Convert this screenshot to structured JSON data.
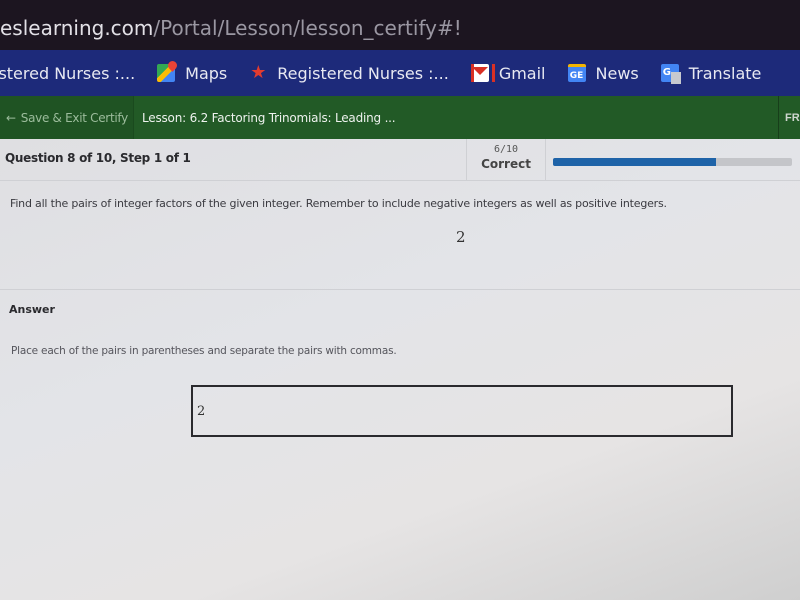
{
  "browser": {
    "url_host": "eslearning.com",
    "url_path": "/Portal/Lesson/lesson_certify#!"
  },
  "bookmarks": [
    {
      "label": "istered Nurses :...",
      "icon": "none"
    },
    {
      "label": "Maps",
      "icon": "maps-icon"
    },
    {
      "label": "Registered Nurses :...",
      "icon": "star-icon"
    },
    {
      "label": "Gmail",
      "icon": "gmail-icon"
    },
    {
      "label": "News",
      "icon": "news-icon",
      "icon_text": "GE"
    },
    {
      "label": "Translate",
      "icon": "translate-icon",
      "icon_text": "G"
    }
  ],
  "lesson_bar": {
    "save_exit_label": "Save & Exit Certify",
    "back_arrow": "←",
    "lesson_title": "Lesson: 6.2 Factoring Trinomials: Leading ...",
    "right_label": "FR"
  },
  "question": {
    "label": "Question 8 of 10, Step 1 of 1",
    "score_fraction": "6/10",
    "score_label": "Correct",
    "progress_percent": 68,
    "prompt": "Find all the pairs of integer factors of the given integer. Remember to include negative integers as well as positive integers.",
    "given_value": "2"
  },
  "answer": {
    "label": "Answer",
    "instructions": "Place each of the pairs in parentheses and separate the pairs with commas.",
    "input_value": "2"
  },
  "colors": {
    "bookmark_bar": "#1d2a7a",
    "lesson_bar": "#225a26",
    "progress_fill": "#1e63a8",
    "progress_track": "#c4c5c9"
  }
}
